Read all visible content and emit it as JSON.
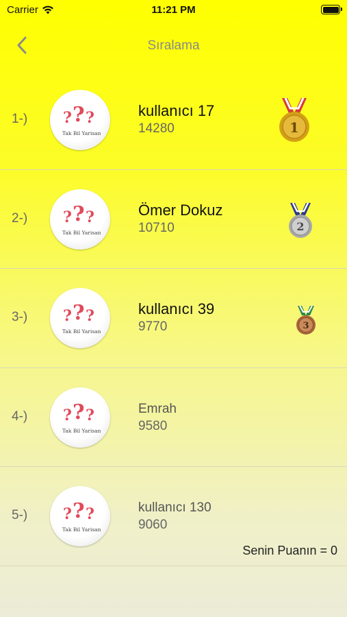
{
  "status": {
    "carrier": "Carrier",
    "time": "11:21 PM"
  },
  "nav": {
    "title": "Sıralama"
  },
  "avatar_logo_text": "Tak Bil Yarisan",
  "rows": [
    {
      "rank": "1-)",
      "name": "kullanıcı 17",
      "score": "14280",
      "medal": "1"
    },
    {
      "rank": "2-)",
      "name": "Ömer Dokuz",
      "score": "10710",
      "medal": "2"
    },
    {
      "rank": "3-)",
      "name": "kullanıcı 39",
      "score": "9770",
      "medal": "3"
    },
    {
      "rank": "4-)",
      "name": "Emrah",
      "score": "9580"
    },
    {
      "rank": "5-)",
      "name": "kullanıcı 130",
      "score": "9060"
    }
  ],
  "footer": {
    "my_score": "Senin Puanın = 0"
  },
  "colors": {
    "gold": "#d4a017",
    "silver": "#b8b8b8",
    "bronze": "#b5703a",
    "question_mark": "#e04a5a"
  }
}
